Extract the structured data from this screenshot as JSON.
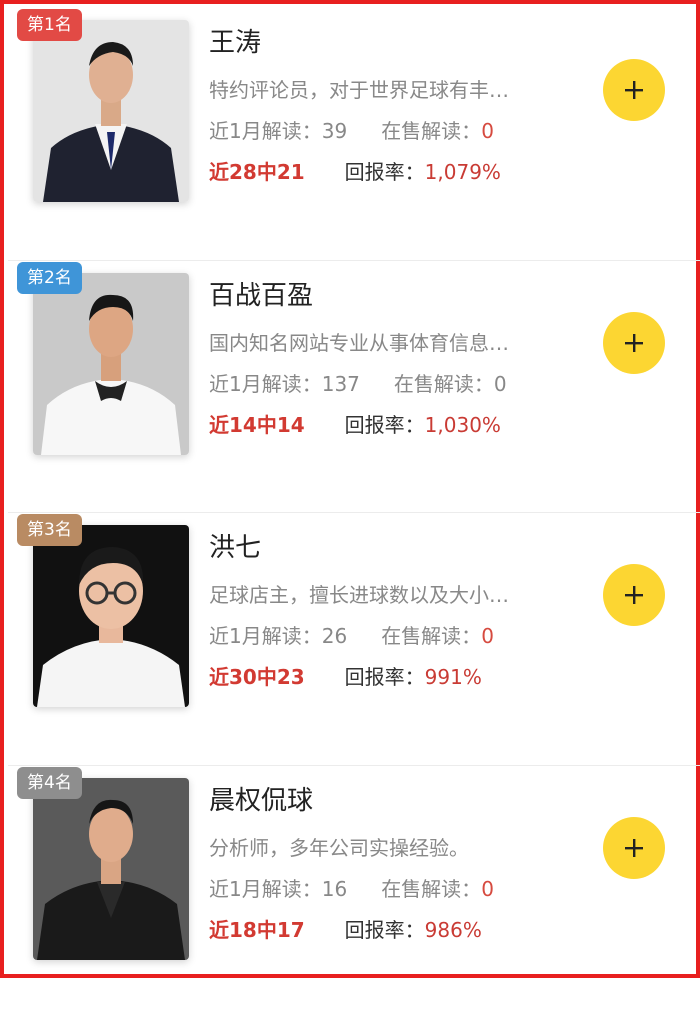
{
  "labels": {
    "month_reads": "近1月解读：",
    "on_sale": "在售解读：",
    "return_rate": "回报率："
  },
  "colors": {
    "accent_red": "#d23a32",
    "follow_yellow": "#fcd632",
    "border_red": "#e8201f"
  },
  "experts": [
    {
      "rank": "第1名",
      "rank_color": "#e24a45",
      "name": "王涛",
      "desc": "特约评论员，对于世界足球有丰…",
      "month_reads": "39",
      "on_sale": "0",
      "record": "近28中21",
      "return_rate": "1,079%",
      "avatar_bg": "#e4e4e4",
      "suit": "#1f2230",
      "shirt": "#f4f4f4"
    },
    {
      "rank": "第2名",
      "rank_color": "#3f95d8",
      "name": "百战百盈",
      "desc": "国内知名网站专业从事体育信息…",
      "month_reads": "137",
      "on_sale": "0",
      "record": "近14中14",
      "return_rate": "1,030%",
      "avatar_bg": "#c9c9c9",
      "suit": "#f7f7f7",
      "shirt": "#f7f7f7"
    },
    {
      "rank": "第3名",
      "rank_color": "#b98b63",
      "name": "洪七",
      "desc": "足球店主，擅长进球数以及大小…",
      "month_reads": "26",
      "on_sale": "0",
      "record": "近30中23",
      "return_rate": "991%",
      "avatar_bg": "#111111",
      "suit": "#f5f5f5",
      "shirt": "#f5f5f5"
    },
    {
      "rank": "第4名",
      "rank_color": "#8e8e8e",
      "name": "晨权侃球",
      "desc": "分析师，多年公司实操经验。",
      "month_reads": "16",
      "on_sale": "0",
      "record": "近18中17",
      "return_rate": "986%",
      "avatar_bg": "#5a5a5a",
      "suit": "#1a1a1a",
      "shirt": "#2a2a2a"
    }
  ]
}
